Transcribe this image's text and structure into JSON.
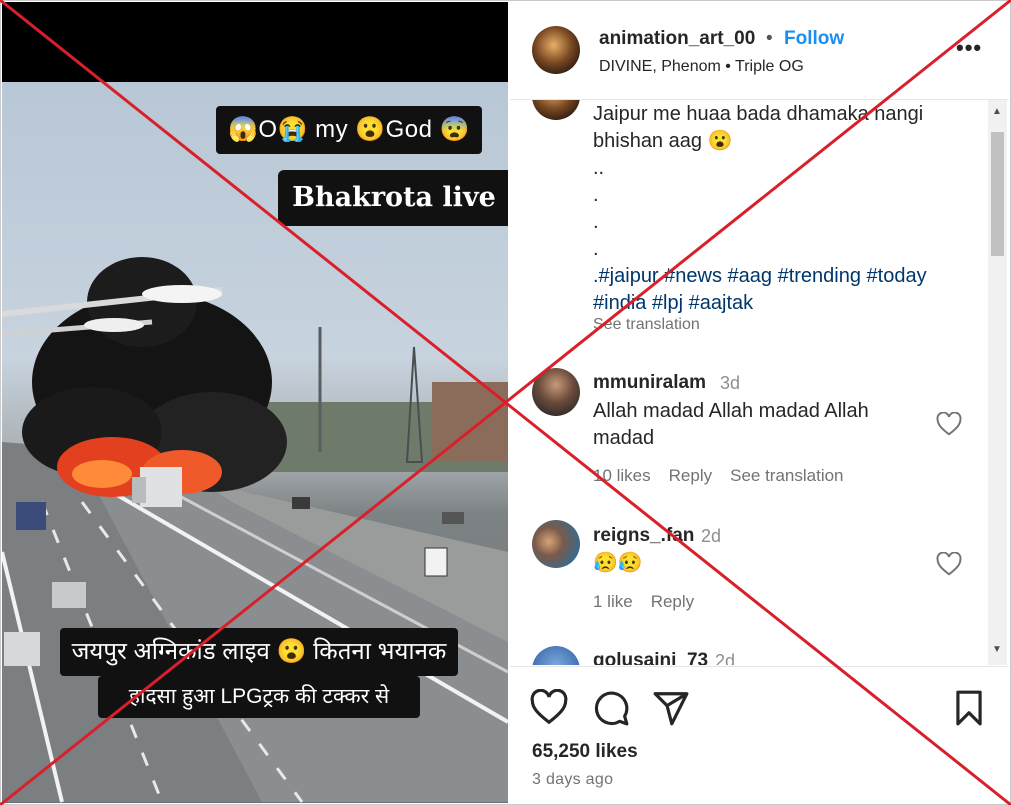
{
  "video": {
    "overlay_top": "😱O😭 my 😮God 😨",
    "overlay_live": "Bhakrota live",
    "overlay_hindi_line1": "जयपुर अग्निकांड लाइव 😮 कितना भयानक",
    "overlay_hindi_line2": "हादसा हुआ LPGट्रक की टक्कर से"
  },
  "post": {
    "username": "animation_art_00",
    "follow_label": "Follow",
    "separator": "•",
    "audio": "DIVINE, Phenom • Triple OG",
    "more_label": "•••",
    "caption_line1": "Jaipur me huaa bada dhamaka nangi",
    "caption_line2": "bhishan aag 😮",
    "caption_dots1": "..",
    "caption_dots2": ".",
    "caption_dots3": ".",
    "caption_dots4": ".",
    "caption_tags1": ".#jaipur #news #aag #trending #today",
    "caption_tags2": "#india #lpj #aajtak",
    "see_translation": "See translation",
    "likes": "65,250 likes",
    "time_ago": "3 days ago"
  },
  "comments": [
    {
      "user": "mmuniralam",
      "time": "3d",
      "text": "Allah madad Allah madad Allah madad",
      "likes": "10 likes",
      "reply": "Reply",
      "see_translation": "See translation"
    },
    {
      "user": "reigns_.fan",
      "time": "2d",
      "text": "😥😥",
      "likes": "1 like",
      "reply": "Reply"
    },
    {
      "user": "golusaini_73",
      "time": "2d"
    }
  ],
  "colors": {
    "follow": "#1a8ff0",
    "hashtag": "#00376b",
    "x_overlay": "#d9202a"
  },
  "icons": [
    "heart-icon",
    "comment-icon",
    "share-icon",
    "bookmark-icon",
    "more-icon"
  ]
}
